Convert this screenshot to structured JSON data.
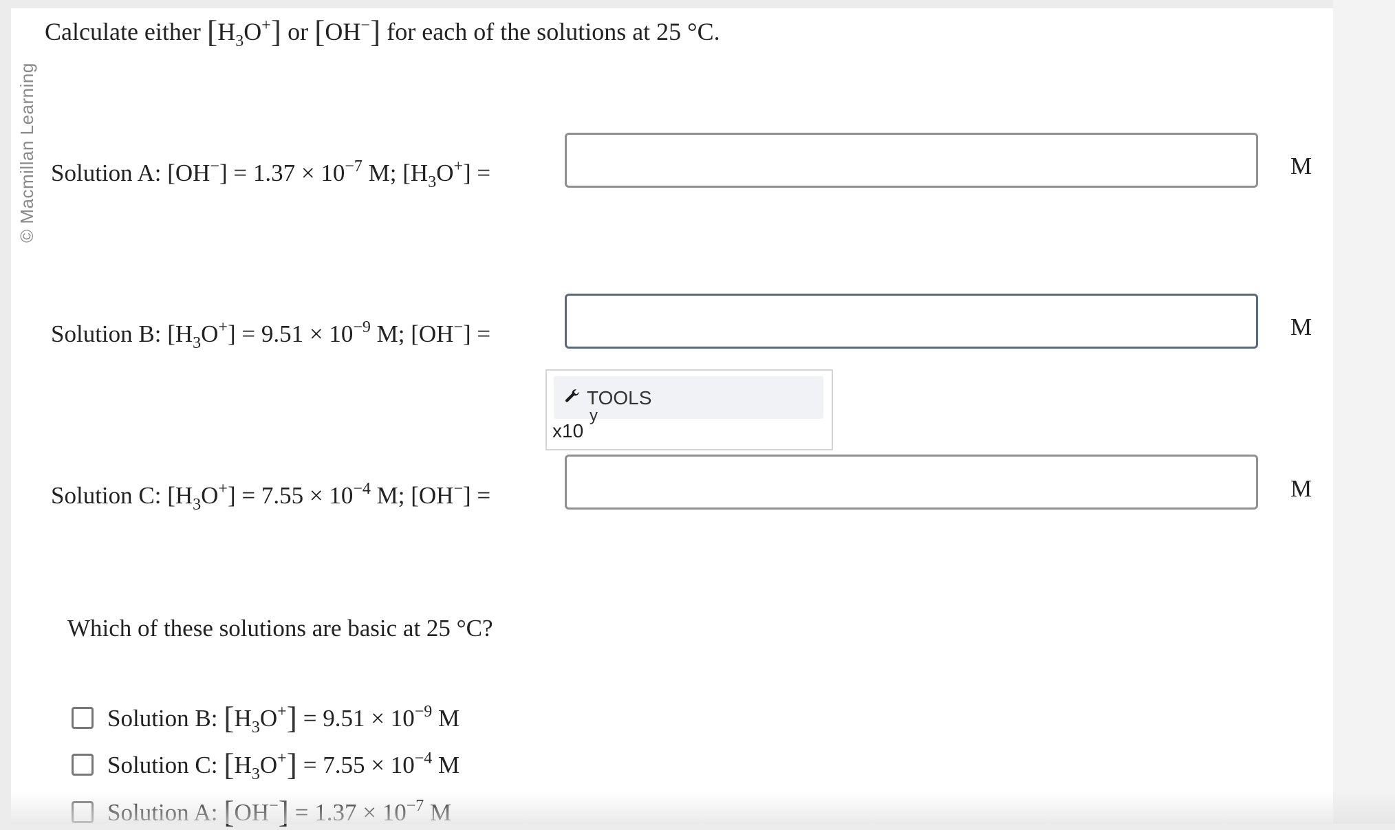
{
  "credit": "© Macmillan Learning",
  "prompt": {
    "pre": "Calculate either",
    "or": "or",
    "post": "for each of the solutions at 25 °C."
  },
  "chem": {
    "h": "H",
    "three": "3",
    "o": "O",
    "plus": "+",
    "oh": "OH",
    "minus": "−"
  },
  "solutions": {
    "a": {
      "pre": "Solution A: [OH",
      "mid1": "] = 1.37 × 10",
      "exp": "−7",
      "mid2": " M; [H",
      "o": "O",
      "end": "] =",
      "unit": "M"
    },
    "b": {
      "pre": "Solution B: [H",
      "o": "O",
      "mid1": "] = 9.51 × 10",
      "exp": "−9",
      "mid2": " M; [OH",
      "end": "] =",
      "unit": "M"
    },
    "c": {
      "pre": "Solution C: [H",
      "o": "O",
      "mid1": "] = 7.55 × 10",
      "exp": "−4",
      "mid2": " M; [OH",
      "end": "] =",
      "unit": "M"
    }
  },
  "tools": {
    "label": "TOOLS",
    "y": "y",
    "x10": "x10"
  },
  "question": "Which of these solutions are basic at 25 °C?",
  "options": [
    {
      "label": "Solution B:",
      "species": "H",
      "value": "= 9.51 × 10",
      "exp": "−9",
      "unit": "M"
    },
    {
      "label": "Solution C:",
      "species": "H",
      "value": "= 7.55 × 10",
      "exp": "−4",
      "unit": "M"
    },
    {
      "label": "Solution A:",
      "species": "OH",
      "value": "= 1.37 × 10",
      "exp": "−7",
      "unit": "M"
    }
  ]
}
